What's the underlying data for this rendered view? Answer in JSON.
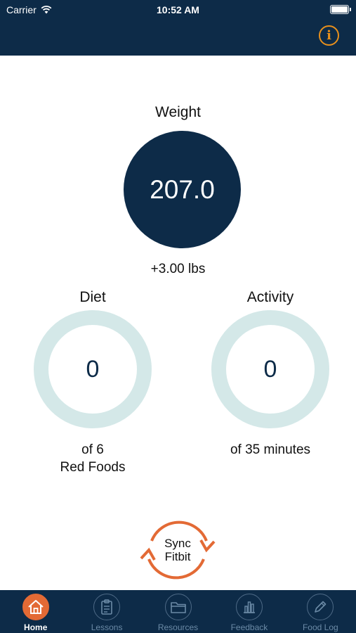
{
  "status_bar": {
    "carrier": "Carrier",
    "time": "10:52 AM"
  },
  "header": {
    "info_icon": "info-icon",
    "info_glyph": "i"
  },
  "weight": {
    "title": "Weight",
    "value": "207.0",
    "change": "+3.00 lbs"
  },
  "diet": {
    "title": "Diet",
    "value": "0",
    "sub_line1": "of 6",
    "sub_line2": "Red Foods"
  },
  "activity": {
    "title": "Activity",
    "value": "0",
    "sub": "of 35 minutes"
  },
  "sync": {
    "line1": "Sync",
    "line2": "Fitbit"
  },
  "tabs": [
    {
      "label": "Home",
      "icon": "home-icon",
      "active": true
    },
    {
      "label": "Lessons",
      "icon": "clipboard-icon",
      "active": false
    },
    {
      "label": "Resources",
      "icon": "folder-icon",
      "active": false
    },
    {
      "label": "Feedback",
      "icon": "bar-chart-icon",
      "active": false
    },
    {
      "label": "Food Log",
      "icon": "pencil-icon",
      "active": false
    }
  ],
  "colors": {
    "navy": "#0d2b48",
    "accent_orange": "#e36a35",
    "info_orange": "#e8901c",
    "ring": "#d4e8e8"
  }
}
